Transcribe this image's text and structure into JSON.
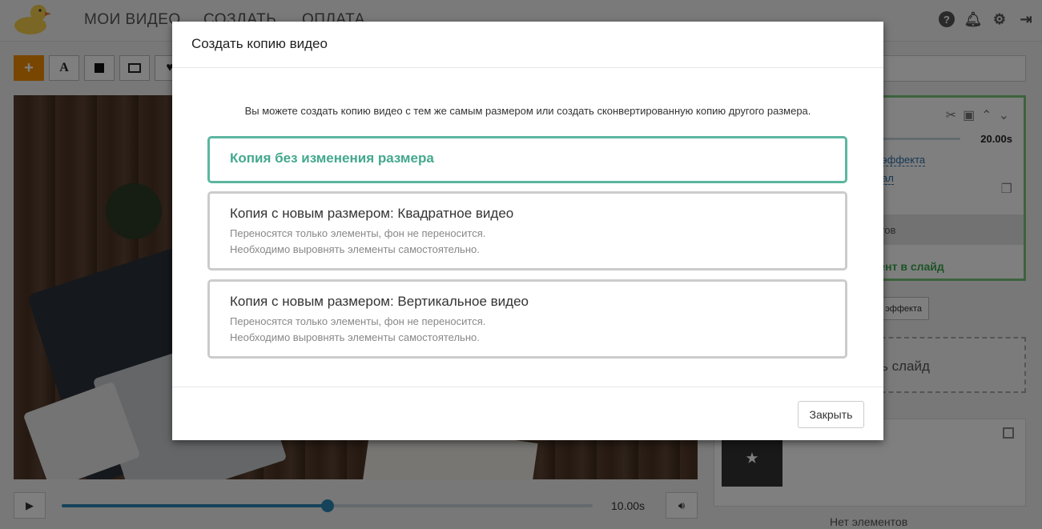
{
  "nav": {
    "items": [
      "МОИ ВИДЕО",
      "СОЗДАТЬ",
      "ОПЛАТА"
    ]
  },
  "icons": {
    "help": "help-icon",
    "notifications": "bell-icon",
    "settings": "gear-icon",
    "logout": "logout-icon"
  },
  "toolbar": {
    "add": "+",
    "text": "A"
  },
  "player": {
    "time": "10.00s",
    "progress": 0.5
  },
  "side_panel": {
    "duration": "20.00s",
    "link_effect": "эффекта",
    "link_original": "ал",
    "elements_header": "ентов",
    "add_to_slide": "мент в слайд",
    "effect_button": "эффекта",
    "add_slide": "ь слайд"
  },
  "bottom_panel": {
    "title": "ы",
    "no_elements": "Нет элементов"
  },
  "modal": {
    "title": "Создать копию видео",
    "intro": "Вы можете создать копию видео с тем же самым размером или создать сконвертированную копию другого размера.",
    "options": [
      {
        "title": "Копия без изменения размера",
        "desc1": "",
        "desc2": ""
      },
      {
        "title": "Копия с новым размером: Квадратное видео",
        "desc1": "Переносятся только элементы, фон не переносится.",
        "desc2": "Необходимо выровнять элементы самостоятельно."
      },
      {
        "title": "Копия с новым размером: Вертикальное видео",
        "desc1": "Переносятся только элементы, фон не переносится.",
        "desc2": "Необходимо выровнять элементы самостоятельно."
      }
    ],
    "close_label": "Закрыть"
  },
  "colors": {
    "accent_green": "#43a88e",
    "player_blue": "#2a87b5",
    "orange": "#f08c00"
  }
}
